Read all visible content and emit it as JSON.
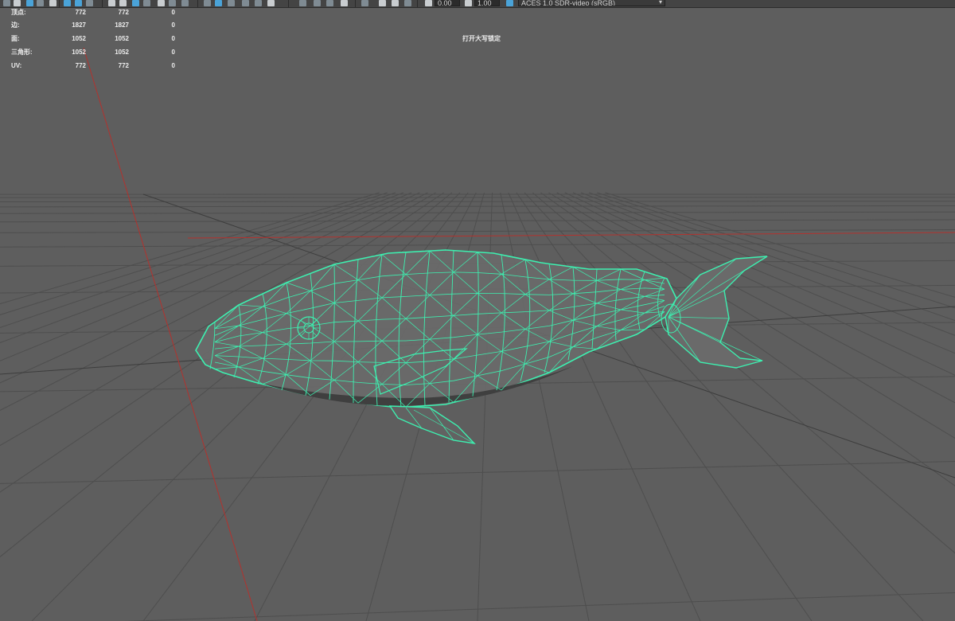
{
  "toolbar": {
    "exposure_value": "0.00",
    "gamma_value": "1.00",
    "color_space": "ACES 1.0 SDR-video (sRGB)"
  },
  "hud": {
    "rows": [
      {
        "label": "顶点:",
        "col1": "772",
        "col2": "772",
        "col3": "0"
      },
      {
        "label": "边:",
        "col1": "1827",
        "col2": "1827",
        "col3": "0"
      },
      {
        "label": "面:",
        "col1": "1052",
        "col2": "1052",
        "col3": "0"
      },
      {
        "label": "三角形:",
        "col1": "1052",
        "col2": "1052",
        "col3": "0"
      },
      {
        "label": "UV:",
        "col1": "772",
        "col2": "772",
        "col3": "0"
      }
    ]
  },
  "status": {
    "caps_lock": "打开大写锁定"
  },
  "colors": {
    "viewport_bg": "#5e5e5e",
    "grid_line": "#4b4b4b",
    "axis_red": "#b3322e",
    "wireframe": "#3df0b0"
  },
  "icons": [
    "view-icon",
    "camera-icon",
    "grid-icon",
    "shading-icon",
    "lighting-icon",
    "isolate-icon",
    "xray-icon",
    "exposure-icon",
    "gamma-icon",
    "color-management-icon"
  ]
}
